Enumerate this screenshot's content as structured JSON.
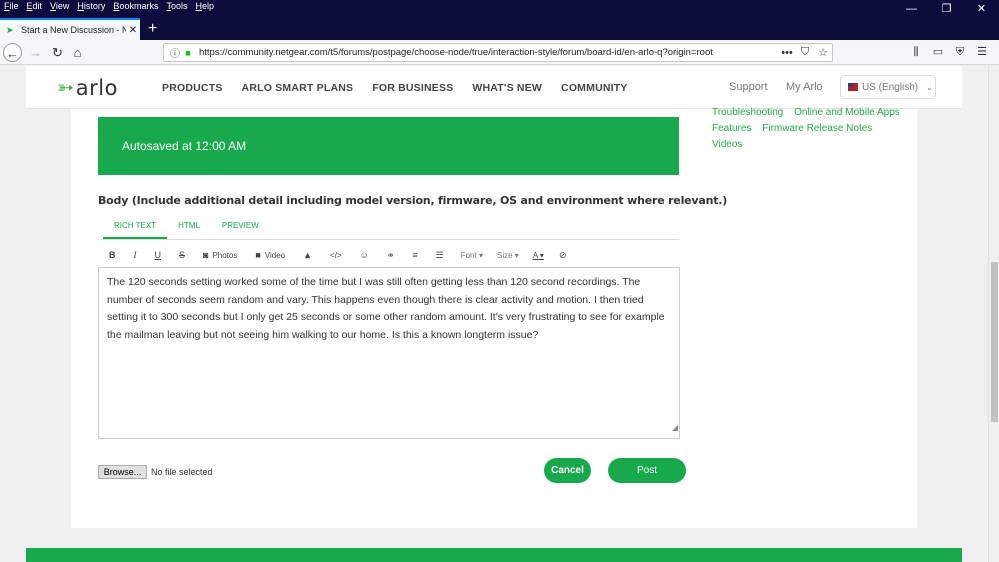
{
  "browser": {
    "menu": [
      "File",
      "Edit",
      "View",
      "History",
      "Bookmarks",
      "Tools",
      "Help"
    ],
    "window_controls": [
      "—",
      "❐",
      "✕"
    ],
    "tab_title": "Start a New Discussion - NETGEAR",
    "tab_close": "✕",
    "new_tab": "+",
    "url": "https://community.netgear.com/t5/forums/postpage/choose-node/true/interaction-style/forum/board-id/en-arlo-q?origin=root",
    "url_icons": [
      "•••",
      "⛉",
      "☆"
    ],
    "toolbar_icons": [
      "⫼",
      "▭",
      "⛨",
      "☰"
    ]
  },
  "header": {
    "logo_text": "arlo",
    "nav": [
      "PRODUCTS",
      "ARLO SMART PLANS",
      "FOR BUSINESS",
      "WHAT'S NEW",
      "COMMUNITY"
    ],
    "support": "Support",
    "my_arlo": "My Arlo",
    "language": "US (English)"
  },
  "sidebar": {
    "row1": [
      "Troubleshooting",
      "Online and Mobile Apps"
    ],
    "row2": [
      "Features",
      "Firmware Release Notes"
    ],
    "row3": [
      "Videos"
    ]
  },
  "main": {
    "autosave": "Autosaved at 12:00 AM",
    "body_label": "Body (Include additional detail including model version, firmware, OS and environment where relevant.)",
    "editor_tabs": [
      "RICH TEXT",
      "HTML",
      "PREVIEW"
    ],
    "toolbar": {
      "bold": "B",
      "italic": "I",
      "underline": "U",
      "strike": "S",
      "photos": "Photos",
      "video": "Video",
      "font": "Font",
      "size": "Size",
      "color": "A"
    },
    "body_text": "The 120 seconds setting worked some of the time but I was still often getting less than 120 second recordings. The number of seconds seem random and vary. This happens even though there is clear activity and motion. I then tried setting it to 300 seconds but I only get 25 seconds or some other random amount. It's very frustrating to see for example the mailman leaving but not seeing him walking to our home. Is this a known longterm issue?",
    "browse": "Browse...",
    "no_file": "No file selected",
    "cancel": "Cancel",
    "post": "Post"
  }
}
